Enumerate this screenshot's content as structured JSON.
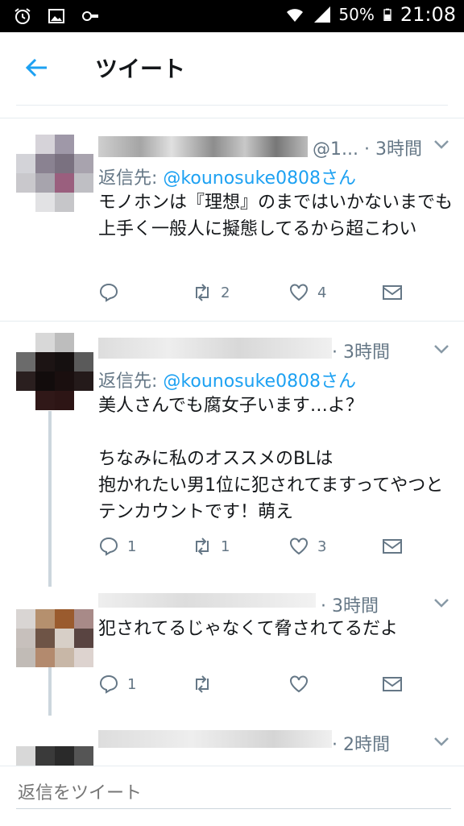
{
  "status_bar": {
    "battery": "50%",
    "time": "21:08"
  },
  "header": {
    "title": "ツイート"
  },
  "tweets": [
    {
      "meta": "@1... · 3時間",
      "reply_prefix": "返信先: ",
      "reply_handle": "@kounosuke0808さん",
      "text": "モノホンは『理想』のまではいかないまでも\n上手く一般人に擬態してるから超こわい",
      "reply_count": "",
      "retweet_count": "2",
      "like_count": "4"
    },
    {
      "meta": "· 3時間",
      "reply_prefix": "返信先: ",
      "reply_handle": "@kounosuke0808さん",
      "text": "美人さんでも腐女子います…よ？\n\nちなみに私のオススメのBLは\n抱かれたい男1位に犯されてますってやつとテンカウントです！萌え",
      "reply_count": "1",
      "retweet_count": "1",
      "like_count": "3"
    },
    {
      "meta": "· 3時間",
      "text": "犯されてるじゃなくて脅されてるだよ",
      "reply_count": "1",
      "retweet_count": "",
      "like_count": ""
    },
    {
      "meta": "· 2時間",
      "text": ""
    }
  ],
  "footer": {
    "placeholder": "返信をツイート"
  },
  "colors": {
    "accent": "#1da1f2",
    "text": "#14171a",
    "secondary": "#657786",
    "divider": "#e6ecf0"
  }
}
